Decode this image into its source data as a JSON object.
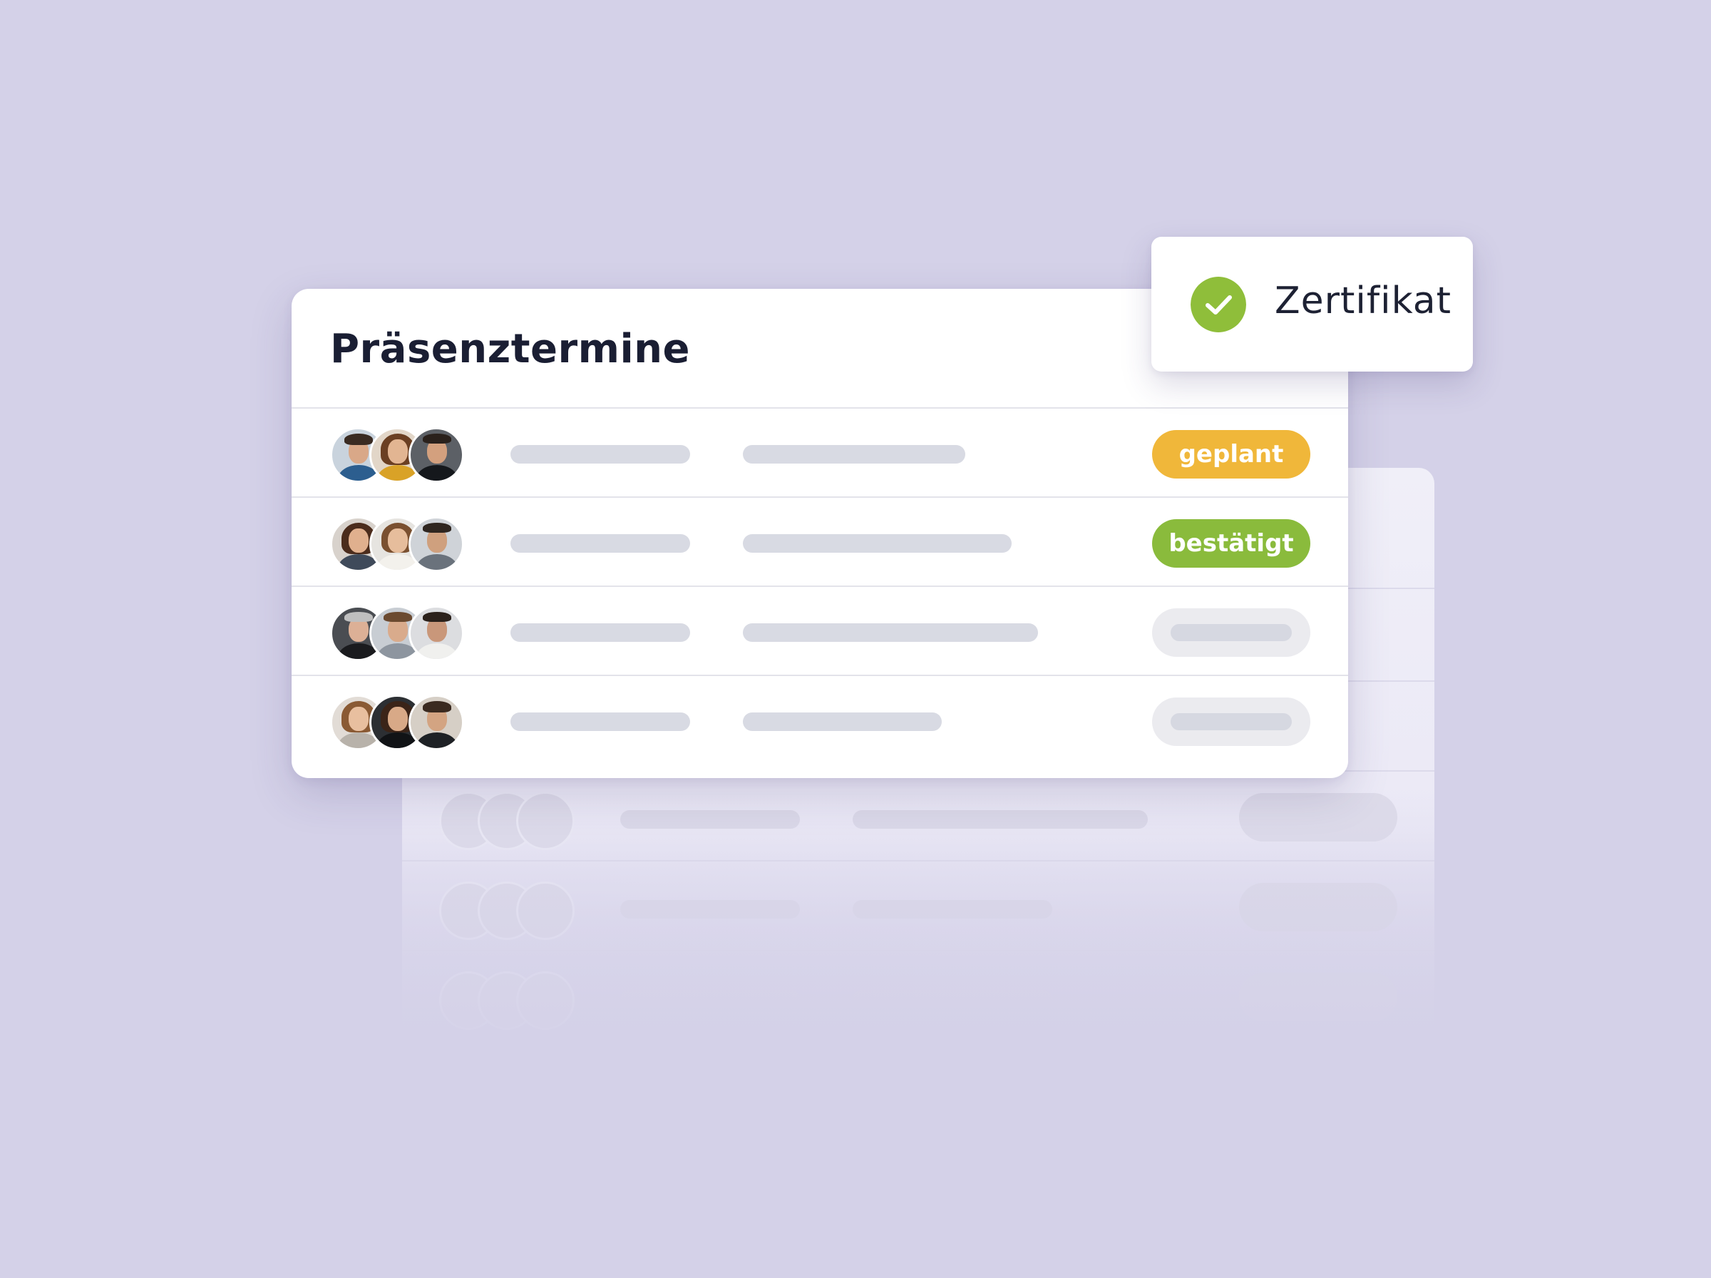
{
  "colors": {
    "background": "#d4d1e8",
    "status_planned": "#f0b73a",
    "status_confirmed": "#8abb3c",
    "check": "#8fbe3a"
  },
  "card": {
    "title": "Präsenztermine",
    "rows": [
      {
        "status": "geplant",
        "status_color": "#f0b73a"
      },
      {
        "status": "bestätigt",
        "status_color": "#8abb3c"
      },
      {
        "status": "",
        "status_color": ""
      },
      {
        "status": "",
        "status_color": ""
      }
    ]
  },
  "certificate": {
    "icon": "check-circle-icon",
    "label": "Zertifikat"
  }
}
